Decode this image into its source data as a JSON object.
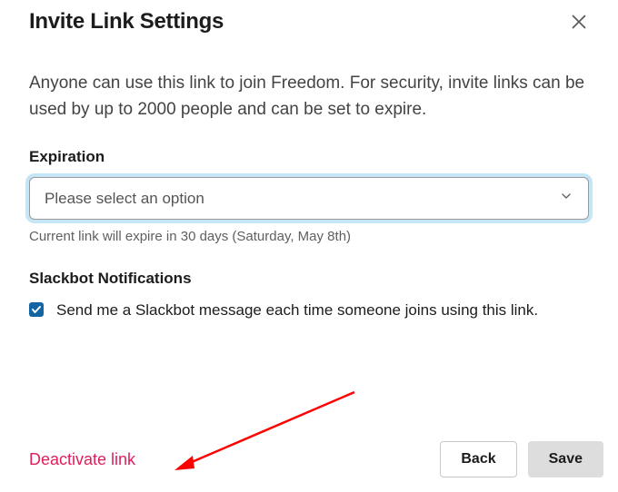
{
  "modal": {
    "title": "Invite Link Settings",
    "description": "Anyone can use this link to join Freedom. For security, invite links can be used by up to 2000 people and can be set to expire."
  },
  "expiration": {
    "label": "Expiration",
    "placeholder": "Please select an option",
    "hint": "Current link will expire in 30 days (Saturday, May 8th)"
  },
  "notifications": {
    "label": "Slackbot Notifications",
    "checkbox_label": "Send me a Slackbot message each time someone joins using this link.",
    "checked": true
  },
  "actions": {
    "deactivate": "Deactivate link",
    "back": "Back",
    "save": "Save"
  },
  "colors": {
    "accent_blue": "#1264a3",
    "focus_ring": "#c4e6f6",
    "danger": "#e01e5a",
    "annotation_red": "#ff0000"
  }
}
